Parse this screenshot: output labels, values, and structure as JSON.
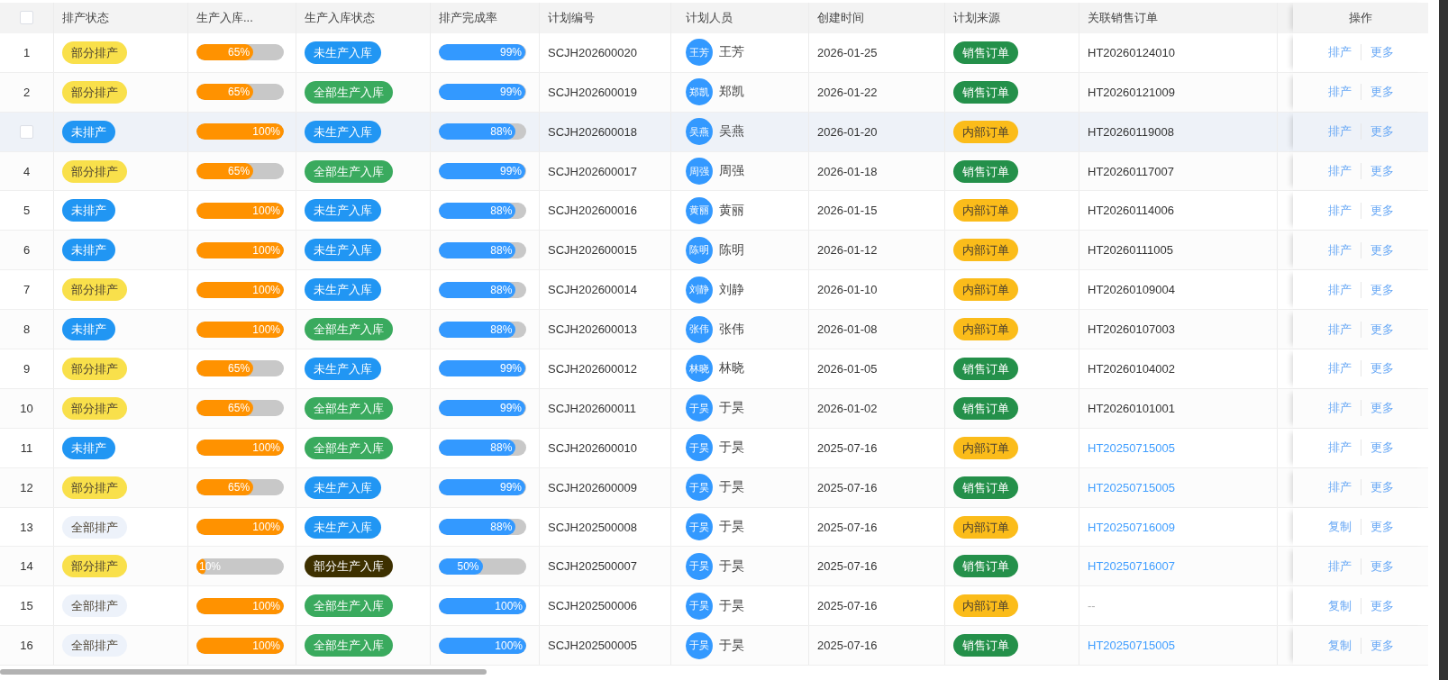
{
  "header_checkbox": {
    "checked": false
  },
  "columns": [
    "排产状态",
    "生产入库...",
    "生产入库状态",
    "排产完成率",
    "计划编号",
    "计划人员",
    "创建时间",
    "计划来源",
    "关联销售订单",
    "操作"
  ],
  "rows": [
    {
      "index": "1",
      "hovered": false,
      "schedule_status": {
        "text": "部分排产",
        "color": "#f9e04b"
      },
      "stock_progress": {
        "level": 0.65,
        "label": "65%"
      },
      "stock_status": {
        "text": "未生产入库",
        "color": "#2196f3"
      },
      "completion": {
        "level": 0.99,
        "label": "99%"
      },
      "plan_no": "SCJH202600020",
      "planner": {
        "avatar": "王芳",
        "name": "王芳"
      },
      "created": "2026-01-25",
      "source": {
        "text": "销售订单",
        "color": "#24904a"
      },
      "sales_order": {
        "text": "HT20260124010",
        "kind": "plain"
      },
      "actions": [
        "排产",
        "更多"
      ]
    },
    {
      "index": "2",
      "hovered": false,
      "schedule_status": {
        "text": "部分排产",
        "color": "#f9e04b"
      },
      "stock_progress": {
        "level": 0.65,
        "label": "65%"
      },
      "stock_status": {
        "text": "全部生产入库",
        "color": "#3aaa5e"
      },
      "completion": {
        "level": 0.99,
        "label": "99%"
      },
      "plan_no": "SCJH202600019",
      "planner": {
        "avatar": "郑凯",
        "name": "郑凯"
      },
      "created": "2026-01-22",
      "source": {
        "text": "销售订单",
        "color": "#24904a"
      },
      "sales_order": {
        "text": "HT20260121009",
        "kind": "plain"
      },
      "actions": [
        "排产",
        "更多"
      ]
    },
    {
      "hovered": true,
      "row_checkbox": {
        "checked": false
      },
      "schedule_status": {
        "text": "未排产",
        "color": "#2196f3"
      },
      "stock_progress": {
        "level": 1,
        "label": "100%"
      },
      "stock_status": {
        "text": "未生产入库",
        "color": "#2196f3"
      },
      "completion": {
        "level": 0.88,
        "label": "88%"
      },
      "plan_no": "SCJH202600018",
      "planner": {
        "avatar": "吴燕",
        "name": "吴燕"
      },
      "created": "2026-01-20",
      "source": {
        "text": "内部订单",
        "color": "#fbbc1a"
      },
      "sales_order": {
        "text": "HT20260119008",
        "kind": "plain"
      },
      "actions": [
        "排产",
        "更多"
      ]
    },
    {
      "index": "4",
      "hovered": false,
      "schedule_status": {
        "text": "部分排产",
        "color": "#f9e04b"
      },
      "stock_progress": {
        "level": 0.65,
        "label": "65%"
      },
      "stock_status": {
        "text": "全部生产入库",
        "color": "#3aaa5e"
      },
      "completion": {
        "level": 0.99,
        "label": "99%"
      },
      "plan_no": "SCJH202600017",
      "planner": {
        "avatar": "周强",
        "name": "周强"
      },
      "created": "2026-01-18",
      "source": {
        "text": "销售订单",
        "color": "#24904a"
      },
      "sales_order": {
        "text": "HT20260117007",
        "kind": "plain"
      },
      "actions": [
        "排产",
        "更多"
      ]
    },
    {
      "index": "5",
      "hovered": false,
      "schedule_status": {
        "text": "未排产",
        "color": "#2196f3"
      },
      "stock_progress": {
        "level": 1,
        "label": "100%"
      },
      "stock_status": {
        "text": "未生产入库",
        "color": "#2196f3"
      },
      "completion": {
        "level": 0.88,
        "label": "88%"
      },
      "plan_no": "SCJH202600016",
      "planner": {
        "avatar": "黄丽",
        "name": "黄丽"
      },
      "created": "2026-01-15",
      "source": {
        "text": "内部订单",
        "color": "#fbbc1a"
      },
      "sales_order": {
        "text": "HT20260114006",
        "kind": "plain"
      },
      "actions": [
        "排产",
        "更多"
      ]
    },
    {
      "index": "6",
      "hovered": false,
      "schedule_status": {
        "text": "未排产",
        "color": "#2196f3"
      },
      "stock_progress": {
        "level": 1,
        "label": "100%"
      },
      "stock_status": {
        "text": "未生产入库",
        "color": "#2196f3"
      },
      "completion": {
        "level": 0.88,
        "label": "88%"
      },
      "plan_no": "SCJH202600015",
      "planner": {
        "avatar": "陈明",
        "name": "陈明"
      },
      "created": "2026-01-12",
      "source": {
        "text": "内部订单",
        "color": "#fbbc1a"
      },
      "sales_order": {
        "text": "HT20260111005",
        "kind": "plain"
      },
      "actions": [
        "排产",
        "更多"
      ]
    },
    {
      "index": "7",
      "hovered": false,
      "schedule_status": {
        "text": "部分排产",
        "color": "#f9e04b"
      },
      "stock_progress": {
        "level": 1,
        "label": "100%"
      },
      "stock_status": {
        "text": "未生产入库",
        "color": "#2196f3"
      },
      "completion": {
        "level": 0.88,
        "label": "88%"
      },
      "plan_no": "SCJH202600014",
      "planner": {
        "avatar": "刘静",
        "name": "刘静"
      },
      "created": "2026-01-10",
      "source": {
        "text": "内部订单",
        "color": "#fbbc1a"
      },
      "sales_order": {
        "text": "HT20260109004",
        "kind": "plain"
      },
      "actions": [
        "排产",
        "更多"
      ]
    },
    {
      "index": "8",
      "hovered": false,
      "schedule_status": {
        "text": "未排产",
        "color": "#2196f3"
      },
      "stock_progress": {
        "level": 1,
        "label": "100%"
      },
      "stock_status": {
        "text": "全部生产入库",
        "color": "#3aaa5e"
      },
      "completion": {
        "level": 0.88,
        "label": "88%"
      },
      "plan_no": "SCJH202600013",
      "planner": {
        "avatar": "张伟",
        "name": "张伟"
      },
      "created": "2026-01-08",
      "source": {
        "text": "内部订单",
        "color": "#fbbc1a"
      },
      "sales_order": {
        "text": "HT20260107003",
        "kind": "plain"
      },
      "actions": [
        "排产",
        "更多"
      ]
    },
    {
      "index": "9",
      "hovered": false,
      "schedule_status": {
        "text": "部分排产",
        "color": "#f9e04b"
      },
      "stock_progress": {
        "level": 0.65,
        "label": "65%"
      },
      "stock_status": {
        "text": "未生产入库",
        "color": "#2196f3"
      },
      "completion": {
        "level": 0.99,
        "label": "99%"
      },
      "plan_no": "SCJH202600012",
      "planner": {
        "avatar": "林晓",
        "name": "林晓"
      },
      "created": "2026-01-05",
      "source": {
        "text": "销售订单",
        "color": "#24904a"
      },
      "sales_order": {
        "text": "HT20260104002",
        "kind": "plain"
      },
      "actions": [
        "排产",
        "更多"
      ]
    },
    {
      "index": "10",
      "hovered": false,
      "schedule_status": {
        "text": "部分排产",
        "color": "#f9e04b"
      },
      "stock_progress": {
        "level": 0.65,
        "label": "65%"
      },
      "stock_status": {
        "text": "全部生产入库",
        "color": "#3aaa5e"
      },
      "completion": {
        "level": 0.99,
        "label": "99%"
      },
      "plan_no": "SCJH202600011",
      "planner": {
        "avatar": "于昊",
        "name": "于昊"
      },
      "created": "2026-01-02",
      "source": {
        "text": "销售订单",
        "color": "#24904a"
      },
      "sales_order": {
        "text": "HT20260101001",
        "kind": "plain"
      },
      "actions": [
        "排产",
        "更多"
      ]
    },
    {
      "index": "11",
      "hovered": false,
      "schedule_status": {
        "text": "未排产",
        "color": "#2196f3"
      },
      "stock_progress": {
        "level": 1,
        "label": "100%"
      },
      "stock_status": {
        "text": "全部生产入库",
        "color": "#3aaa5e"
      },
      "completion": {
        "level": 0.88,
        "label": "88%"
      },
      "plan_no": "SCJH202600010",
      "planner": {
        "avatar": "于昊",
        "name": "于昊"
      },
      "created": "2025-07-16",
      "source": {
        "text": "内部订单",
        "color": "#fbbc1a"
      },
      "sales_order": {
        "text": "HT20250715005",
        "kind": "link"
      },
      "actions": [
        "排产",
        "更多"
      ]
    },
    {
      "index": "12",
      "hovered": false,
      "schedule_status": {
        "text": "部分排产",
        "color": "#f9e04b"
      },
      "stock_progress": {
        "level": 0.65,
        "label": "65%"
      },
      "stock_status": {
        "text": "未生产入库",
        "color": "#2196f3"
      },
      "completion": {
        "level": 0.99,
        "label": "99%"
      },
      "plan_no": "SCJH202600009",
      "planner": {
        "avatar": "于昊",
        "name": "于昊"
      },
      "created": "2025-07-16",
      "source": {
        "text": "销售订单",
        "color": "#24904a"
      },
      "sales_order": {
        "text": "HT20250715005",
        "kind": "link"
      },
      "actions": [
        "排产",
        "更多"
      ]
    },
    {
      "index": "13",
      "hovered": false,
      "schedule_status": {
        "text": "全部排产",
        "color": "#edf2fa"
      },
      "stock_progress": {
        "level": 1,
        "label": "100%"
      },
      "stock_status": {
        "text": "未生产入库",
        "color": "#2196f3"
      },
      "completion": {
        "level": 0.88,
        "label": "88%"
      },
      "plan_no": "SCJH202500008",
      "planner": {
        "avatar": "于昊",
        "name": "于昊"
      },
      "created": "2025-07-16",
      "source": {
        "text": "内部订单",
        "color": "#fbbc1a"
      },
      "sales_order": {
        "text": "HT20250716009",
        "kind": "link"
      },
      "actions": [
        "复制",
        "更多"
      ]
    },
    {
      "index": "14",
      "hovered": false,
      "schedule_status": {
        "text": "部分排产",
        "color": "#f9e04b"
      },
      "stock_progress": {
        "level": 0.1,
        "label": "10%"
      },
      "stock_status": {
        "text": "部分生产入库",
        "color": "#3d3000"
      },
      "completion": {
        "level": 0.5,
        "label": "50%"
      },
      "plan_no": "SCJH202500007",
      "planner": {
        "avatar": "于昊",
        "name": "于昊"
      },
      "created": "2025-07-16",
      "source": {
        "text": "销售订单",
        "color": "#24904a"
      },
      "sales_order": {
        "text": "HT20250716007",
        "kind": "link"
      },
      "actions": [
        "排产",
        "更多"
      ]
    },
    {
      "index": "15",
      "hovered": false,
      "schedule_status": {
        "text": "全部排产",
        "color": "#edf2fa"
      },
      "stock_progress": {
        "level": 1,
        "label": "100%"
      },
      "stock_status": {
        "text": "全部生产入库",
        "color": "#3aaa5e"
      },
      "completion": {
        "level": 1,
        "label": "100%"
      },
      "plan_no": "SCJH202500006",
      "planner": {
        "avatar": "于昊",
        "name": "于昊"
      },
      "created": "2025-07-16",
      "source": {
        "text": "内部订单",
        "color": "#fbbc1a"
      },
      "sales_order": {
        "text": "--",
        "kind": "empty"
      },
      "actions": [
        "复制",
        "更多"
      ]
    },
    {
      "index": "16",
      "hovered": false,
      "schedule_status": {
        "text": "全部排产",
        "color": "#edf2fa"
      },
      "stock_progress": {
        "level": 1,
        "label": "100%"
      },
      "stock_status": {
        "text": "全部生产入库",
        "color": "#3aaa5e"
      },
      "completion": {
        "level": 1,
        "label": "100%"
      },
      "plan_no": "SCJH202500005",
      "planner": {
        "avatar": "于昊",
        "name": "于昊"
      },
      "created": "2025-07-16",
      "source": {
        "text": "销售订单",
        "color": "#24904a"
      },
      "sales_order": {
        "text": "HT20250715005",
        "kind": "link"
      },
      "actions": [
        "复制",
        "更多"
      ]
    }
  ]
}
